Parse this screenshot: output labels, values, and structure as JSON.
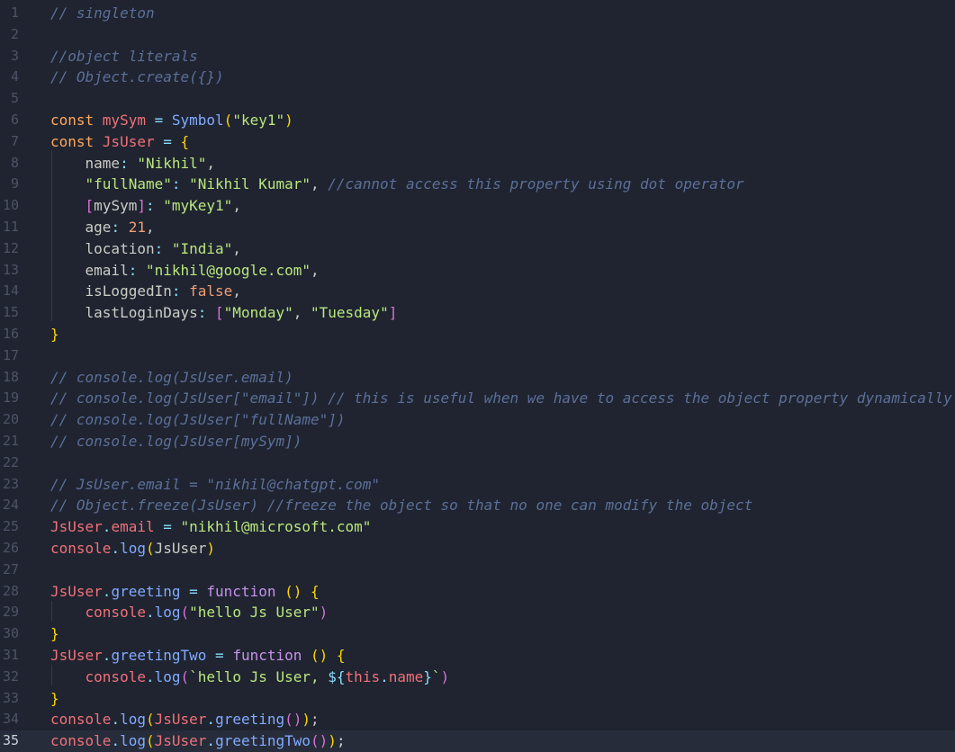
{
  "editor": {
    "current_line": 35,
    "lines": [
      {
        "n": "1",
        "tokens": [
          [
            "t-comment",
            "// singleton"
          ]
        ]
      },
      {
        "n": "2",
        "tokens": []
      },
      {
        "n": "3",
        "tokens": [
          [
            "t-comment",
            "//object literals"
          ]
        ]
      },
      {
        "n": "4",
        "tokens": [
          [
            "t-comment",
            "// Object.create({})"
          ]
        ]
      },
      {
        "n": "5",
        "tokens": []
      },
      {
        "n": "6",
        "tokens": [
          [
            "t-kw",
            "const "
          ],
          [
            "t-var",
            "mySym"
          ],
          [
            "t-op",
            " = "
          ],
          [
            "t-fn",
            "Symbol"
          ],
          [
            "t-br1",
            "("
          ],
          [
            "t-str",
            "\"key1\""
          ],
          [
            "t-br1",
            ")"
          ]
        ]
      },
      {
        "n": "7",
        "tokens": [
          [
            "t-kw",
            "const "
          ],
          [
            "t-var",
            "JsUser"
          ],
          [
            "t-op",
            " = "
          ],
          [
            "t-br1",
            "{"
          ]
        ]
      },
      {
        "n": "8",
        "tokens": [
          [
            "t-plain",
            "    name"
          ],
          [
            "t-op",
            ": "
          ],
          [
            "t-str",
            "\"Nikhil\""
          ],
          [
            "t-plain",
            ","
          ]
        ]
      },
      {
        "n": "9",
        "tokens": [
          [
            "t-plain",
            "    "
          ],
          [
            "t-str",
            "\"fullName\""
          ],
          [
            "t-op",
            ": "
          ],
          [
            "t-str",
            "\"Nikhil Kumar\""
          ],
          [
            "t-plain",
            ", "
          ],
          [
            "t-comment",
            "//cannot access this property using dot operator"
          ]
        ]
      },
      {
        "n": "10",
        "tokens": [
          [
            "t-plain",
            "    "
          ],
          [
            "t-br2",
            "["
          ],
          [
            "t-plain",
            "mySym"
          ],
          [
            "t-br2",
            "]"
          ],
          [
            "t-op",
            ": "
          ],
          [
            "t-str",
            "\"myKey1\""
          ],
          [
            "t-plain",
            ","
          ]
        ]
      },
      {
        "n": "11",
        "tokens": [
          [
            "t-plain",
            "    age"
          ],
          [
            "t-op",
            ": "
          ],
          [
            "t-num",
            "21"
          ],
          [
            "t-plain",
            ","
          ]
        ]
      },
      {
        "n": "12",
        "tokens": [
          [
            "t-plain",
            "    location"
          ],
          [
            "t-op",
            ": "
          ],
          [
            "t-str",
            "\"India\""
          ],
          [
            "t-plain",
            ","
          ]
        ]
      },
      {
        "n": "13",
        "tokens": [
          [
            "t-plain",
            "    email"
          ],
          [
            "t-op",
            ": "
          ],
          [
            "t-str",
            "\"nikhil@google.com\""
          ],
          [
            "t-plain",
            ","
          ]
        ]
      },
      {
        "n": "14",
        "tokens": [
          [
            "t-plain",
            "    isLoggedIn"
          ],
          [
            "t-op",
            ": "
          ],
          [
            "t-num",
            "false"
          ],
          [
            "t-plain",
            ","
          ]
        ]
      },
      {
        "n": "15",
        "tokens": [
          [
            "t-plain",
            "    lastLoginDays"
          ],
          [
            "t-op",
            ": "
          ],
          [
            "t-br2",
            "["
          ],
          [
            "t-str",
            "\"Monday\""
          ],
          [
            "t-plain",
            ", "
          ],
          [
            "t-str",
            "\"Tuesday\""
          ],
          [
            "t-br2",
            "]"
          ]
        ]
      },
      {
        "n": "16",
        "tokens": [
          [
            "t-br1",
            "}"
          ]
        ]
      },
      {
        "n": "17",
        "tokens": []
      },
      {
        "n": "18",
        "tokens": [
          [
            "t-comment",
            "// console.log(JsUser.email)"
          ]
        ]
      },
      {
        "n": "19",
        "tokens": [
          [
            "t-comment",
            "// console.log(JsUser[\"email\"]) // this is useful when we have to access the object property dynamically"
          ]
        ]
      },
      {
        "n": "20",
        "tokens": [
          [
            "t-comment",
            "// console.log(JsUser[\"fullName\"])"
          ]
        ]
      },
      {
        "n": "21",
        "tokens": [
          [
            "t-comment",
            "// console.log(JsUser[mySym])"
          ]
        ]
      },
      {
        "n": "22",
        "tokens": []
      },
      {
        "n": "23",
        "tokens": [
          [
            "t-comment",
            "// JsUser.email = \"nikhil@chatgpt.com\""
          ]
        ]
      },
      {
        "n": "24",
        "tokens": [
          [
            "t-comment",
            "// Object.freeze(JsUser) //freeze the object so that no one can modify the object"
          ]
        ]
      },
      {
        "n": "25",
        "tokens": [
          [
            "t-var",
            "JsUser"
          ],
          [
            "t-op",
            "."
          ],
          [
            "t-var",
            "email"
          ],
          [
            "t-op",
            " = "
          ],
          [
            "t-str",
            "\"nikhil@microsoft.com\""
          ]
        ]
      },
      {
        "n": "26",
        "tokens": [
          [
            "t-var",
            "console"
          ],
          [
            "t-op",
            "."
          ],
          [
            "t-fn",
            "log"
          ],
          [
            "t-br1",
            "("
          ],
          [
            "t-plain",
            "JsUser"
          ],
          [
            "t-br1",
            ")"
          ]
        ]
      },
      {
        "n": "27",
        "tokens": []
      },
      {
        "n": "28",
        "tokens": [
          [
            "t-var",
            "JsUser"
          ],
          [
            "t-op",
            "."
          ],
          [
            "t-fn",
            "greeting"
          ],
          [
            "t-op",
            " = "
          ],
          [
            "t-kw2",
            "function "
          ],
          [
            "t-br1",
            "()"
          ],
          [
            "t-plain",
            " "
          ],
          [
            "t-br1",
            "{"
          ]
        ]
      },
      {
        "n": "29",
        "tokens": [
          [
            "t-plain",
            "    "
          ],
          [
            "t-var",
            "console"
          ],
          [
            "t-op",
            "."
          ],
          [
            "t-fn",
            "log"
          ],
          [
            "t-br2",
            "("
          ],
          [
            "t-str",
            "\"hello Js User\""
          ],
          [
            "t-br2",
            ")"
          ]
        ]
      },
      {
        "n": "30",
        "tokens": [
          [
            "t-br1",
            "}"
          ]
        ]
      },
      {
        "n": "31",
        "tokens": [
          [
            "t-var",
            "JsUser"
          ],
          [
            "t-op",
            "."
          ],
          [
            "t-fn",
            "greetingTwo"
          ],
          [
            "t-op",
            " = "
          ],
          [
            "t-kw2",
            "function "
          ],
          [
            "t-br1",
            "()"
          ],
          [
            "t-plain",
            " "
          ],
          [
            "t-br1",
            "{"
          ]
        ]
      },
      {
        "n": "32",
        "tokens": [
          [
            "t-plain",
            "    "
          ],
          [
            "t-var",
            "console"
          ],
          [
            "t-op",
            "."
          ],
          [
            "t-fn",
            "log"
          ],
          [
            "t-br2",
            "("
          ],
          [
            "t-str",
            "`hello Js User, "
          ],
          [
            "t-tmpl",
            "${"
          ],
          [
            "t-this",
            "this"
          ],
          [
            "t-op",
            "."
          ],
          [
            "t-var",
            "name"
          ],
          [
            "t-tmpl",
            "}"
          ],
          [
            "t-str",
            "`"
          ],
          [
            "t-br2",
            ")"
          ]
        ]
      },
      {
        "n": "33",
        "tokens": [
          [
            "t-br1",
            "}"
          ]
        ]
      },
      {
        "n": "34",
        "tokens": [
          [
            "t-var",
            "console"
          ],
          [
            "t-op",
            "."
          ],
          [
            "t-fn",
            "log"
          ],
          [
            "t-br1",
            "("
          ],
          [
            "t-var",
            "JsUser"
          ],
          [
            "t-op",
            "."
          ],
          [
            "t-fn",
            "greeting"
          ],
          [
            "t-br2",
            "()"
          ],
          [
            "t-br1",
            ")"
          ],
          [
            "t-plain",
            ";"
          ]
        ]
      },
      {
        "n": "35",
        "tokens": [
          [
            "t-var",
            "console"
          ],
          [
            "t-op",
            "."
          ],
          [
            "t-fn",
            "log"
          ],
          [
            "t-br1",
            "("
          ],
          [
            "t-var",
            "JsUser"
          ],
          [
            "t-op",
            "."
          ],
          [
            "t-fn",
            "greetingTwo"
          ],
          [
            "t-br2",
            "()"
          ],
          [
            "t-br1",
            ")"
          ],
          [
            "t-plain",
            ";"
          ]
        ]
      }
    ]
  }
}
